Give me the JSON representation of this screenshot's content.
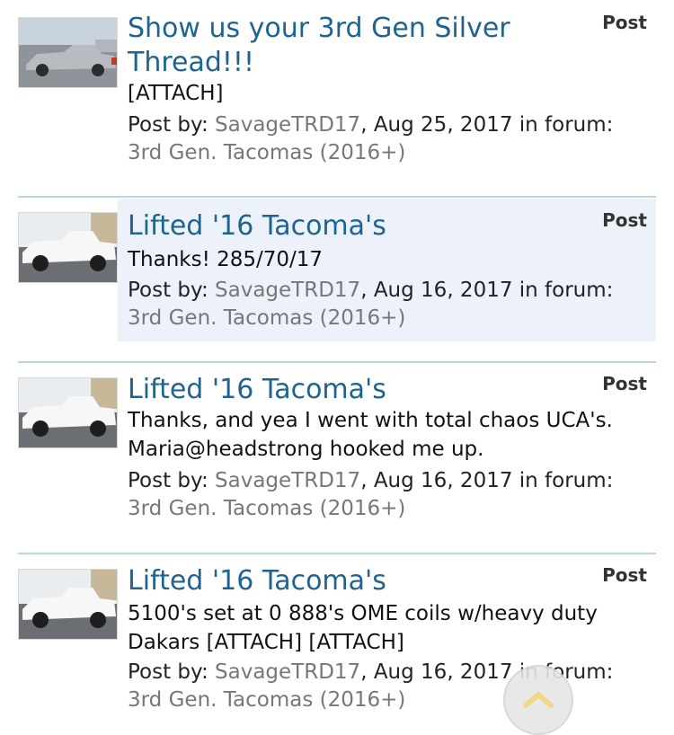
{
  "results": [
    {
      "title": "Show us your 3rd Gen Silver Thread!!!",
      "type": "Post",
      "snippet": "[ATTACH]",
      "post_by_prefix": "Post by: ",
      "user": "SavageTRD17",
      "date_text": ", Aug 25, 2017 in forum:",
      "forum": "3rd Gen. Tacomas (2016+)",
      "thumb_color": "#9aa0a6"
    },
    {
      "title": "Lifted '16 Tacoma's",
      "type": "Post",
      "snippet": "Thanks! 285/70/17",
      "post_by_prefix": "Post by: ",
      "user": "SavageTRD17",
      "date_text": ", Aug 16, 2017 in forum:",
      "forum": "3rd Gen. Tacomas (2016+)",
      "thumb_color": "#f4f4f4"
    },
    {
      "title": "Lifted '16 Tacoma's",
      "type": "Post",
      "snippet": "Thanks, and yea I went with total chaos UCA's. Maria@headstrong hooked me up.",
      "post_by_prefix": "Post by: ",
      "user": "SavageTRD17",
      "date_text": ", Aug 16, 2017 in forum:",
      "forum": "3rd Gen. Tacomas (2016+)",
      "thumb_color": "#f4f4f4"
    },
    {
      "title": "Lifted '16 Tacoma's",
      "type": "Post",
      "snippet": "5100's set at 0 888's OME coils w/heavy duty Dakars [ATTACH] [ATTACH]",
      "post_by_prefix": "Post by: ",
      "user": "SavageTRD17",
      "date_text": ", Aug 16, 2017 in forum:",
      "forum": "3rd Gen. Tacomas (2016+)",
      "thumb_color": "#f4f4f4"
    }
  ],
  "colors": {
    "link": "#1f6390",
    "highlight": "#edf1f9",
    "divider": "#bcd6de",
    "scroll_arrow": "#f2d27a"
  },
  "icons": {
    "scroll_top": "chevron-up-icon"
  }
}
